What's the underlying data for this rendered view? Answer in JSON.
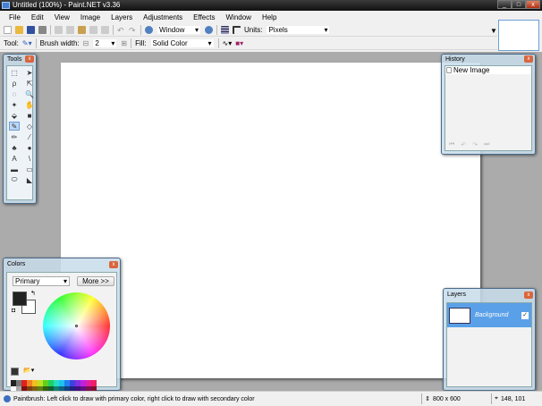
{
  "window": {
    "title": "Untitled (100%) - Paint.NET v3.36",
    "min": "_",
    "max": "□",
    "close": "x"
  },
  "menu": [
    "File",
    "Edit",
    "View",
    "Image",
    "Layers",
    "Adjustments",
    "Effects",
    "Window",
    "Help"
  ],
  "toolbar1": {
    "zoom_value": "Window",
    "units_label": "Units:",
    "units_value": "Pixels"
  },
  "toolbar2": {
    "tool_label": "Tool:",
    "brush_width_label": "Brush width:",
    "brush_width_value": "2",
    "fill_label": "Fill:",
    "fill_value": "Solid Color"
  },
  "tools": {
    "title": "Tools",
    "items": [
      "rectangle-select",
      "move-selection",
      "lasso-select",
      "move-selected",
      "ellipse-select",
      "zoom",
      "magic-wand",
      "pan",
      "paint-bucket",
      "gradient",
      "paintbrush",
      "eraser",
      "pencil",
      "color-picker",
      "clone-stamp",
      "recolor",
      "text",
      "line-curve",
      "rectangle",
      "rounded-rectangle",
      "ellipse",
      "freeform-shape"
    ],
    "glyphs": [
      "⬚",
      "➤",
      "ρ",
      "⇱",
      "◌",
      "🔍",
      "✦",
      "✋",
      "⬙",
      "■",
      "✎",
      "◇",
      "✏",
      "⁄",
      "♣",
      "●",
      "A",
      "\\",
      "▬",
      "▭",
      "⬭",
      "◣"
    ],
    "selected": 10
  },
  "history": {
    "title": "History",
    "items": [
      "New Image"
    ]
  },
  "colors": {
    "title": "Colors",
    "mode": "Primary",
    "more_button": "More >>",
    "primary": "#222222",
    "secondary": "#ffffff",
    "palette_top": [
      "#222222",
      "#777777",
      "#e02020",
      "#f08020",
      "#f0c020",
      "#c0e020",
      "#60d020",
      "#20d060",
      "#20e0c0",
      "#20c0f0",
      "#2080f0",
      "#4040e0",
      "#8030e0",
      "#c020e0",
      "#e020a0",
      "#f02060"
    ],
    "palette_bottom": [
      "#ffffff",
      "#aaaaaa",
      "#801010",
      "#804010",
      "#806010",
      "#608010",
      "#306010",
      "#106030",
      "#108070",
      "#106080",
      "#104080",
      "#202080",
      "#401080",
      "#601080",
      "#801050",
      "#801030"
    ]
  },
  "layers": {
    "title": "Layers",
    "items": [
      {
        "name": "Background",
        "visible": true
      }
    ]
  },
  "status": {
    "message": "Paintbrush: Left click to draw with primary color, right click to draw with secondary color",
    "image_size": "800 x 600",
    "cursor_pos": "148, 101"
  }
}
